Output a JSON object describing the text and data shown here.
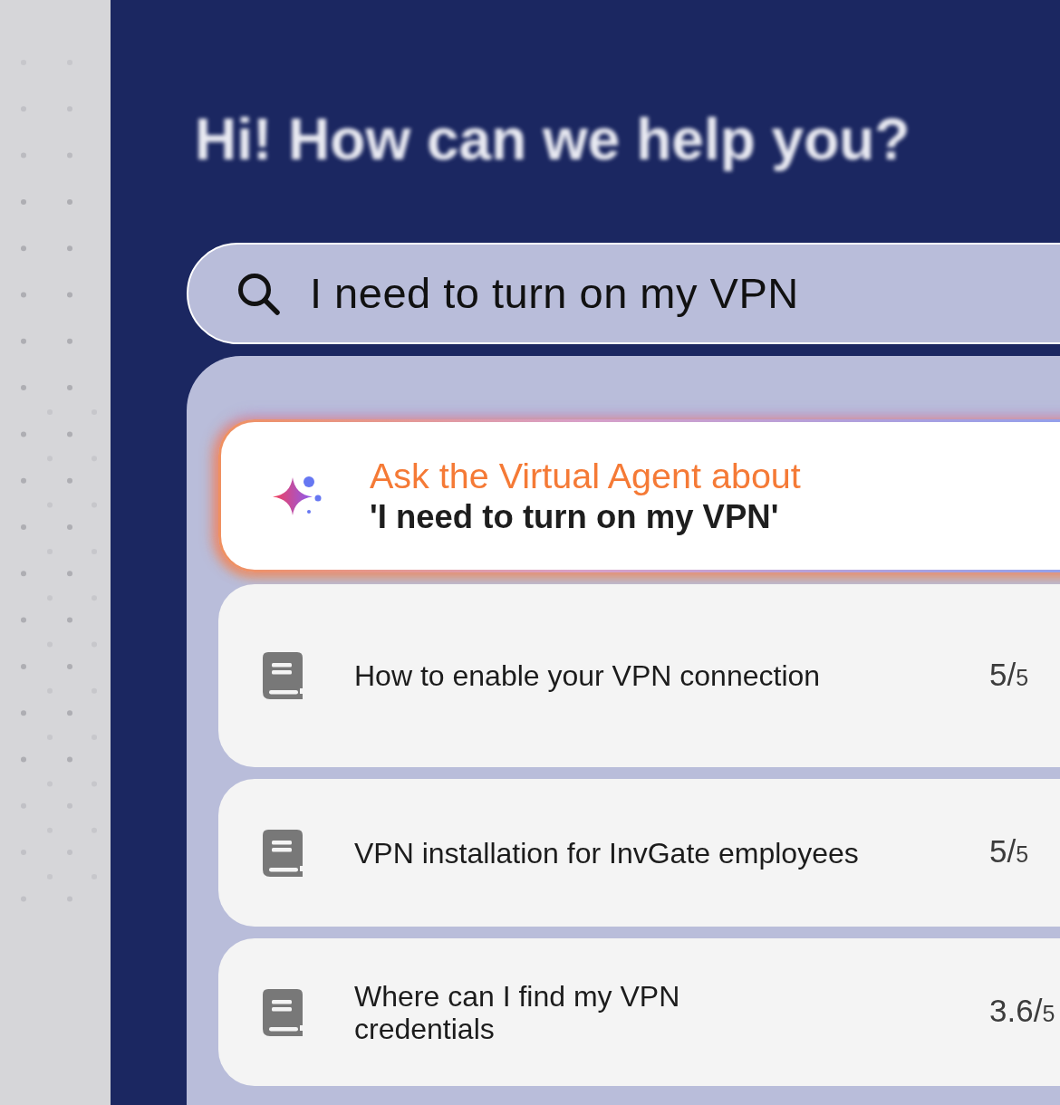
{
  "greeting": {
    "title": "Hi! How can we help you?"
  },
  "search": {
    "value": "I need to turn on my VPN"
  },
  "virtual_agent": {
    "prompt": "Ask the Virtual Agent about",
    "query": "'I need to turn on my VPN'"
  },
  "articles": [
    {
      "title": "How to enable your VPN connection",
      "rating": {
        "score": "5/",
        "scale": "5"
      }
    },
    {
      "title": "VPN installation for InvGate employees",
      "rating": {
        "score": "5/",
        "scale": "5"
      }
    },
    {
      "title": "Where can I find my VPN\ncredentials",
      "rating": {
        "score": "3.6/",
        "scale": "5"
      }
    }
  ]
}
